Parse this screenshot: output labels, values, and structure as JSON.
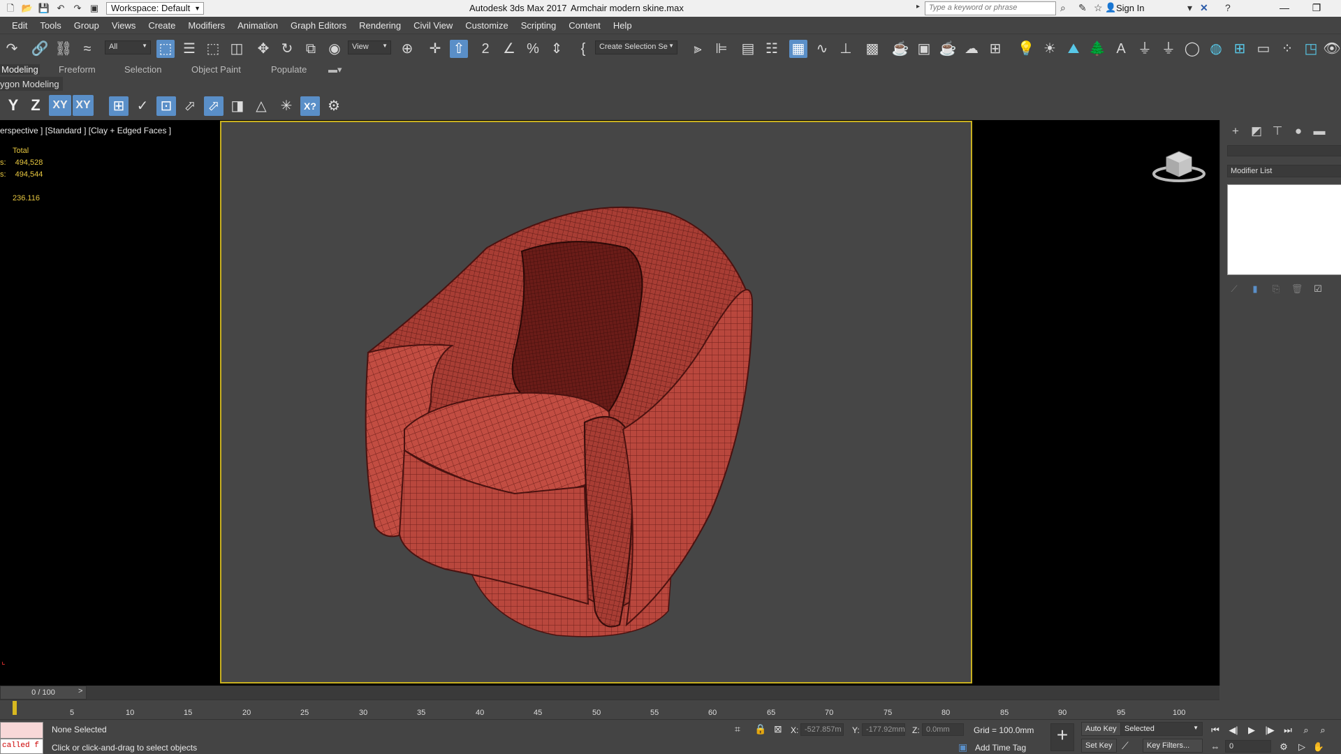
{
  "titlebar": {
    "workspace": "Workspace: Default",
    "app_title": "Autodesk 3ds Max 2017",
    "file_name": "Armchair modern skine.max",
    "search_placeholder": "Type a keyword or phrase",
    "sign_in": "Sign In"
  },
  "menu": [
    "Edit",
    "Tools",
    "Group",
    "Views",
    "Create",
    "Modifiers",
    "Animation",
    "Graph Editors",
    "Rendering",
    "Civil View",
    "Customize",
    "Scripting",
    "Content",
    "Help"
  ],
  "toolbar": {
    "filter": "All",
    "ref_coord": "View",
    "selection_set": "Create Selection Se"
  },
  "ribbon": {
    "tabs": [
      "Modeling",
      "Freeform",
      "Selection",
      "Object Paint",
      "Populate"
    ],
    "active_tab": "Modeling",
    "panel_label": "ygon Modeling"
  },
  "axis_buttons": [
    "Y",
    "Z",
    "XY",
    "XY"
  ],
  "viewport": {
    "label": "erspective ] [Standard ] [Clay + Edged Faces ]",
    "stats_header": "Total",
    "stat1_label": "s:",
    "stat1_value": "494,528",
    "stat2_label": "s:",
    "stat2_value": "494,544",
    "fps": "236.116"
  },
  "command_panel": {
    "modifier_list": "Modifier List"
  },
  "timeline": {
    "slider": "0 / 100",
    "ticks": [
      "5",
      "10",
      "15",
      "20",
      "25",
      "30",
      "35",
      "40",
      "45",
      "50",
      "55",
      "60",
      "65",
      "70",
      "75",
      "80",
      "85",
      "90",
      "95",
      "100"
    ]
  },
  "status": {
    "maxscript_text": "called f",
    "selection": "None Selected",
    "prompt": "Click or click-and-drag to select objects",
    "x_label": "X:",
    "x_value": "-527.857m",
    "y_label": "Y:",
    "y_value": "-177.92mm",
    "z_label": "Z:",
    "z_value": "0.0mm",
    "grid": "Grid = 100.0mm",
    "add_time_tag": "Add Time Tag",
    "auto_key": "Auto Key",
    "selected": "Selected",
    "set_key": "Set Key",
    "key_filters": "Key Filters...",
    "frame": "0"
  },
  "colors": {
    "accent": "#5a8fc8",
    "viewport_border": "#c8b020",
    "mesh": "#b8443a",
    "stats": "#e8c840"
  }
}
